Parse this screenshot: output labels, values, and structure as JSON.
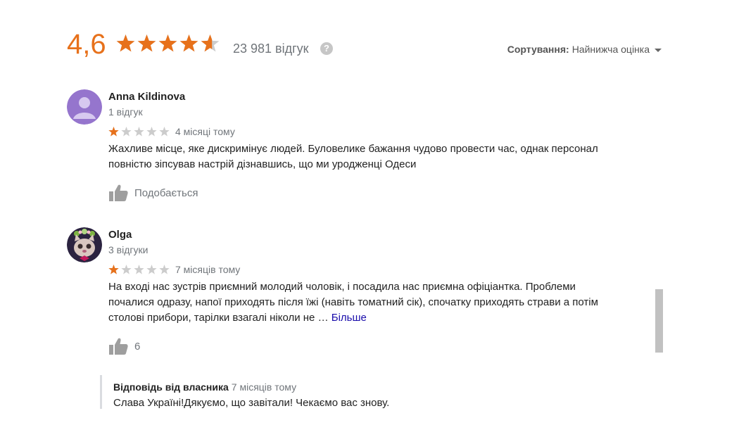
{
  "summary": {
    "rating": "4,6",
    "stars": 4.6,
    "review_count": "23 981 відгук",
    "help_icon": "?",
    "sort_label": "Сортування:",
    "sort_value": "Найнижча оцінка"
  },
  "colors": {
    "star_filled": "#e7711b",
    "star_empty": "#cccccc",
    "rating_text": "#e7711b",
    "link": "#1a0dab",
    "muted": "#70757a"
  },
  "reviews": [
    {
      "author": "Anna Kildinova",
      "meta": "1 відгук",
      "stars": 1,
      "time": "4 місяці тому",
      "text": "Жахливе місце, яке дискримінує людей. Буловелике бажання чудово провести час, однак персонал повністю зіпсував настрій дізнавшись, що ми уродженці Одеси",
      "like_label": "Подобається",
      "avatar": "default-person-avatar"
    },
    {
      "author": "Olga",
      "meta": "3 відгуки",
      "stars": 1,
      "time": "7 місяців тому",
      "text": "На вході нас зустрів приємний молодий чоловік, і посадила нас приємна офіціантка. Проблеми почалися одразу, напої приходять після їжі (навіть томатний сік), спочатку приходять страви а потім столові прибори, тарілки взагалі ніколи не …",
      "more": "Більше",
      "like_label": "6",
      "avatar": "cat-with-flower-crown-avatar"
    }
  ],
  "owner_reply": {
    "title": "Відповідь від власника",
    "time": "7 місяців тому",
    "text": "Слава Україні!Дякуємо, що завітали! Чекаємо вас знову."
  },
  "icons": [
    "star-icon",
    "help-icon",
    "caret-down-icon",
    "thumbs-up-icon"
  ]
}
